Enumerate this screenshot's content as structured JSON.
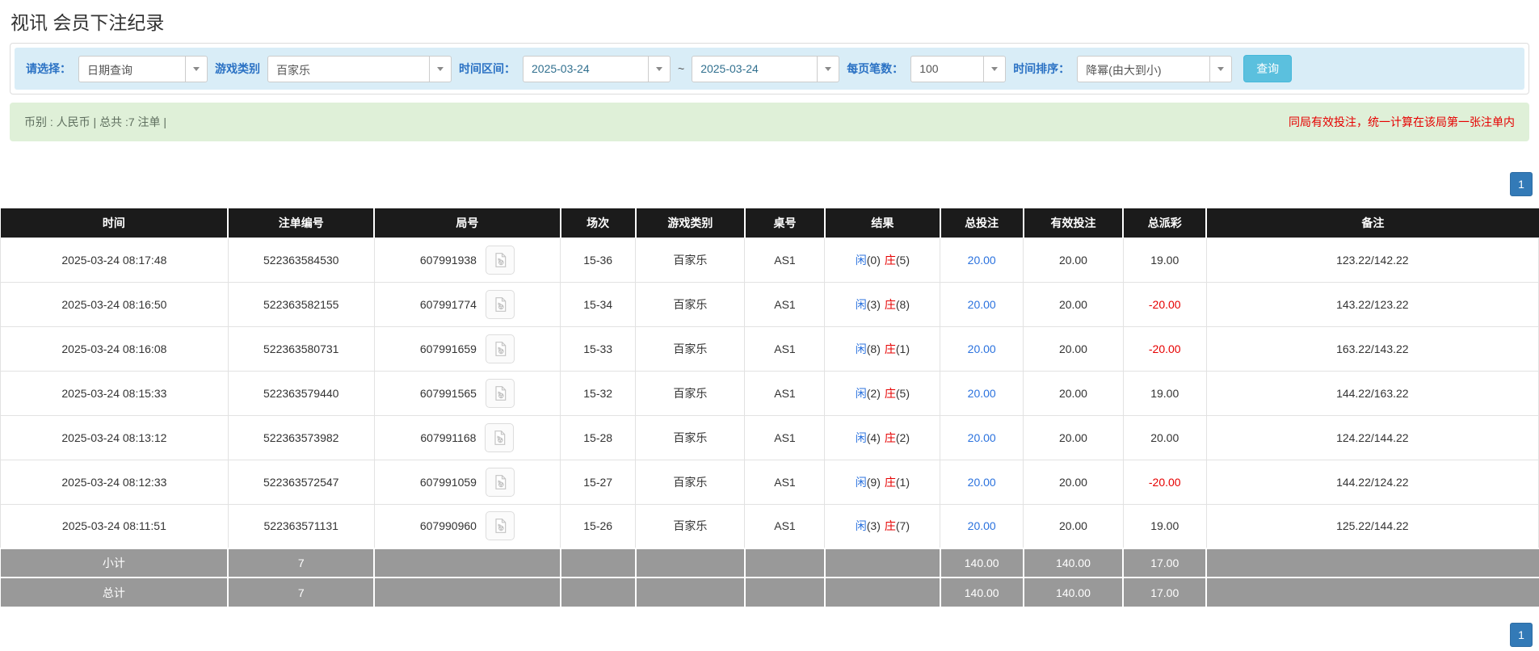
{
  "page": {
    "title": "视讯 会员下注纪录"
  },
  "filters": {
    "select_label": "请选择：",
    "select_value": "日期查询",
    "game_label": "游戏类别",
    "game_value": "百家乐",
    "range_label": "时间区间：",
    "date_from": "2025-03-24",
    "range_separator": "~",
    "date_to": "2025-03-24",
    "page_size_label": "每页笔数：",
    "page_size_value": "100",
    "sort_label": "时间排序：",
    "sort_value": "降幂(由大到小)",
    "query_button": "查询"
  },
  "info_bar": {
    "left": "币别 : 人民币 | 总共 :7 注单 |",
    "right": "同局有效投注，统一计算在该局第一张注单内"
  },
  "pagination": {
    "page_top": "1",
    "page_bottom": "1"
  },
  "table": {
    "headers": [
      "时间",
      "注单编号",
      "局号",
      "场次",
      "游戏类别",
      "桌号",
      "结果",
      "总投注",
      "有效投注",
      "总派彩",
      "备注"
    ],
    "rows": [
      {
        "time": "2025-03-24 08:17:48",
        "bet_id": "522363584530",
        "round_id": "607991938",
        "session": "15-36",
        "game": "百家乐",
        "table_no": "AS1",
        "result": {
          "player_label": "闲",
          "player_score": "(0)",
          "banker_label": "庄",
          "banker_score": "(5)"
        },
        "total_bet": "20.00",
        "valid_bet": "20.00",
        "payout": "19.00",
        "payout_tone": "pos",
        "remark": "123.22/142.22"
      },
      {
        "time": "2025-03-24 08:16:50",
        "bet_id": "522363582155",
        "round_id": "607991774",
        "session": "15-34",
        "game": "百家乐",
        "table_no": "AS1",
        "result": {
          "player_label": "闲",
          "player_score": "(3)",
          "banker_label": "庄",
          "banker_score": "(8)"
        },
        "total_bet": "20.00",
        "valid_bet": "20.00",
        "payout": "-20.00",
        "payout_tone": "neg",
        "remark": "143.22/123.22"
      },
      {
        "time": "2025-03-24 08:16:08",
        "bet_id": "522363580731",
        "round_id": "607991659",
        "session": "15-33",
        "game": "百家乐",
        "table_no": "AS1",
        "result": {
          "player_label": "闲",
          "player_score": "(8)",
          "banker_label": "庄",
          "banker_score": "(1)"
        },
        "total_bet": "20.00",
        "valid_bet": "20.00",
        "payout": "-20.00",
        "payout_tone": "neg",
        "remark": "163.22/143.22"
      },
      {
        "time": "2025-03-24 08:15:33",
        "bet_id": "522363579440",
        "round_id": "607991565",
        "session": "15-32",
        "game": "百家乐",
        "table_no": "AS1",
        "result": {
          "player_label": "闲",
          "player_score": "(2)",
          "banker_label": "庄",
          "banker_score": "(5)"
        },
        "total_bet": "20.00",
        "valid_bet": "20.00",
        "payout": "19.00",
        "payout_tone": "pos",
        "remark": "144.22/163.22"
      },
      {
        "time": "2025-03-24 08:13:12",
        "bet_id": "522363573982",
        "round_id": "607991168",
        "session": "15-28",
        "game": "百家乐",
        "table_no": "AS1",
        "result": {
          "player_label": "闲",
          "player_score": "(4)",
          "banker_label": "庄",
          "banker_score": "(2)"
        },
        "total_bet": "20.00",
        "valid_bet": "20.00",
        "payout": "20.00",
        "payout_tone": "pos",
        "remark": "124.22/144.22"
      },
      {
        "time": "2025-03-24 08:12:33",
        "bet_id": "522363572547",
        "round_id": "607991059",
        "session": "15-27",
        "game": "百家乐",
        "table_no": "AS1",
        "result": {
          "player_label": "闲",
          "player_score": "(9)",
          "banker_label": "庄",
          "banker_score": "(1)"
        },
        "total_bet": "20.00",
        "valid_bet": "20.00",
        "payout": "-20.00",
        "payout_tone": "neg",
        "remark": "144.22/124.22"
      },
      {
        "time": "2025-03-24 08:11:51",
        "bet_id": "522363571131",
        "round_id": "607990960",
        "session": "15-26",
        "game": "百家乐",
        "table_no": "AS1",
        "result": {
          "player_label": "闲",
          "player_score": "(3)",
          "banker_label": "庄",
          "banker_score": "(7)"
        },
        "total_bet": "20.00",
        "valid_bet": "20.00",
        "payout": "19.00",
        "payout_tone": "pos",
        "remark": "125.22/144.22"
      }
    ],
    "subtotal": {
      "label": "小计",
      "count": "7",
      "total_bet": "140.00",
      "valid_bet": "140.00",
      "payout": "17.00"
    },
    "total": {
      "label": "总计",
      "count": "7",
      "total_bet": "140.00",
      "valid_bet": "140.00",
      "payout": "17.00"
    }
  },
  "icons": {
    "video_replay": "video-file-icon",
    "dropdown": "chevron-down-icon"
  },
  "colors": {
    "filter_bar_bg": "#d9edf7",
    "filter_label_blue": "#2b72c4",
    "query_button_cyan": "#5bc0de",
    "info_bar_bg": "#dff0d8",
    "alert_red": "#e60000",
    "link_blue": "#2b72de",
    "player_blue": "#2b72de",
    "banker_red": "#e60000",
    "table_header_bg": "#1b1b1b",
    "summary_row_bg": "#999999",
    "pagination_blue": "#337ab7"
  }
}
